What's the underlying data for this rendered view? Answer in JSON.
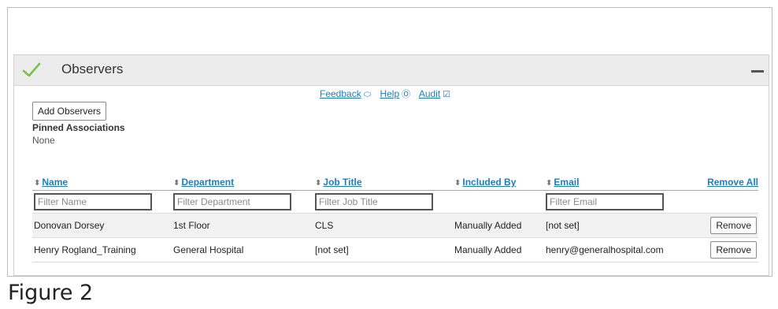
{
  "panel": {
    "title": "Observers",
    "links": {
      "feedback": "Feedback",
      "help": "Help",
      "audit": "Audit"
    },
    "add_button": "Add Observers",
    "pinned_label": "Pinned Associations",
    "pinned_value": "None"
  },
  "table": {
    "columns": {
      "name": "Name",
      "department": "Department",
      "job_title": "Job Title",
      "included_by": "Included By",
      "email": "Email",
      "remove_all": "Remove All"
    },
    "filters": {
      "name": "Filter Name",
      "department": "Filter Department",
      "job_title": "Filter Job Title",
      "email": "Filter Email"
    },
    "rows": [
      {
        "name": "Donovan Dorsey",
        "department": "1st Floor",
        "job_title": "CLS",
        "included_by": "Manually Added",
        "email": "[not set]",
        "action": "Remove"
      },
      {
        "name": "Henry Rogland_Training",
        "department": "General Hospital",
        "job_title": "[not set]",
        "included_by": "Manually Added",
        "email": "henry@generalhospital.com",
        "action": "Remove"
      }
    ]
  },
  "caption": "Figure 2",
  "colors": {
    "link": "#1a7ec2",
    "check": "#7cc24a",
    "header_bg": "#ececec"
  }
}
